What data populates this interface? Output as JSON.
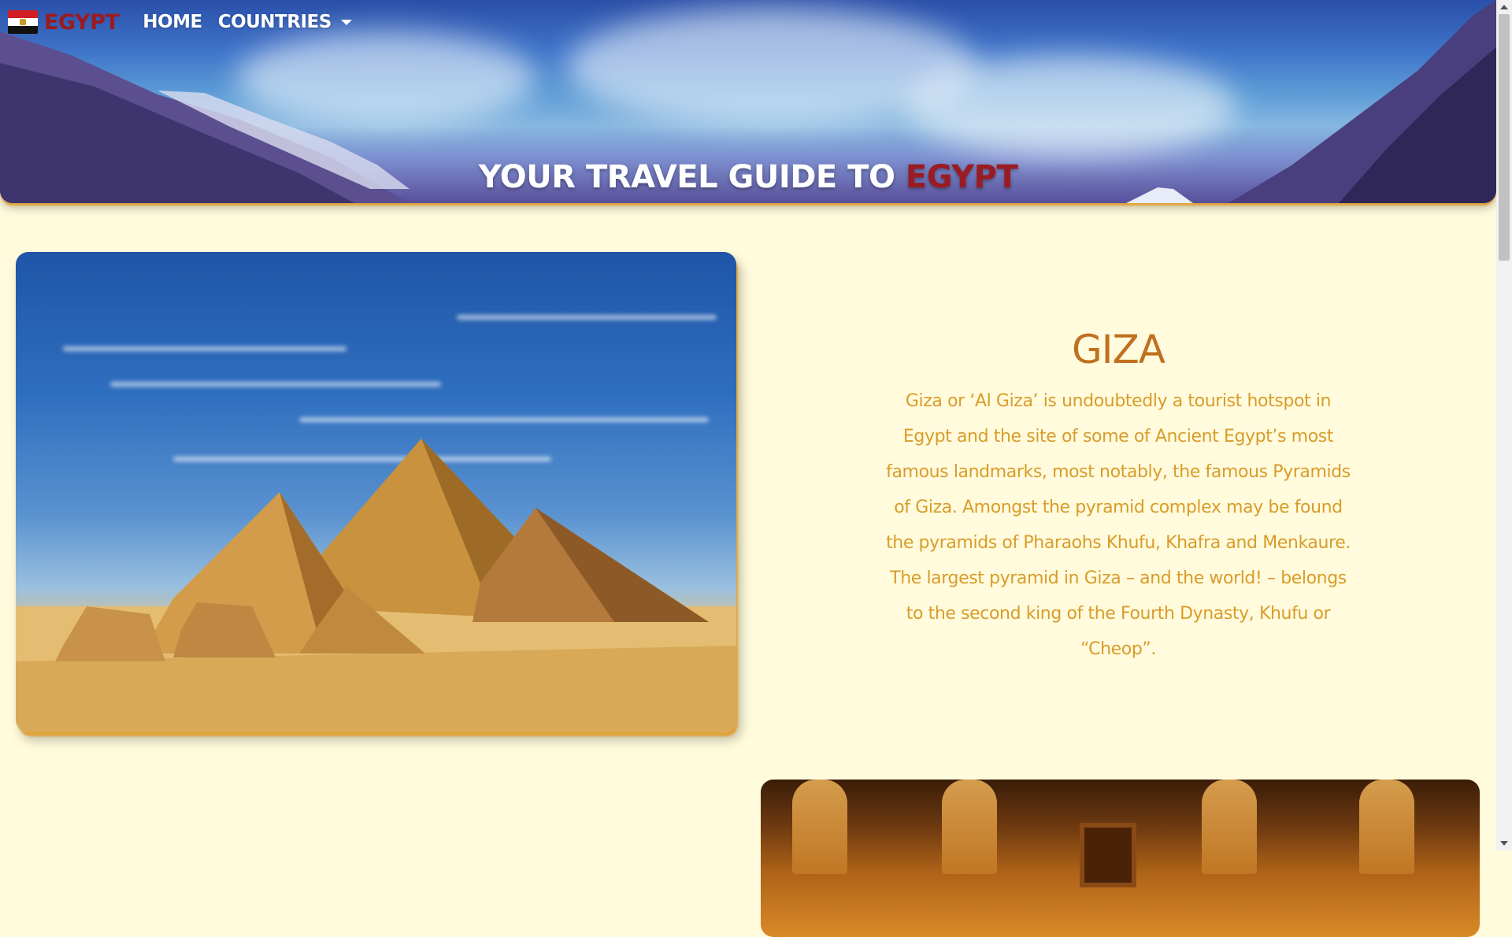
{
  "nav": {
    "brand": "EGYPT",
    "flag_icon": "egypt-flag-icon",
    "links": [
      {
        "label": "HOME"
      },
      {
        "label": "COUNTRIES",
        "has_dropdown": true
      }
    ]
  },
  "hero": {
    "title_prefix": "YOUR TRAVEL GUIDE TO ",
    "title_highlight": "EGYPT"
  },
  "sections": [
    {
      "title": "GIZA",
      "description": "Giza or ‘Al Giza’ is undoubtedly a tourist hotspot in Egypt and the site of some of Ancient Egypt’s most famous landmarks, most notably, the famous Pyramids of Giza. Amongst the pyramid complex may be found the pyramids of Pharaohs Khufu, Khafra and Menkaure. The largest pyramid in Giza – and the world! – belongs to the second king of the Fourth Dynasty, Khufu or “Cheop”.",
      "image": "pyramids-of-giza-photo"
    },
    {
      "image": "temple-statues-photo"
    }
  ],
  "colors": {
    "page_background": "#fffbdc",
    "brand_red": "#9b1b22",
    "title_orange": "#c0701f",
    "text_gold": "#d99c2b",
    "shadow_gold": "#e0a43a"
  }
}
